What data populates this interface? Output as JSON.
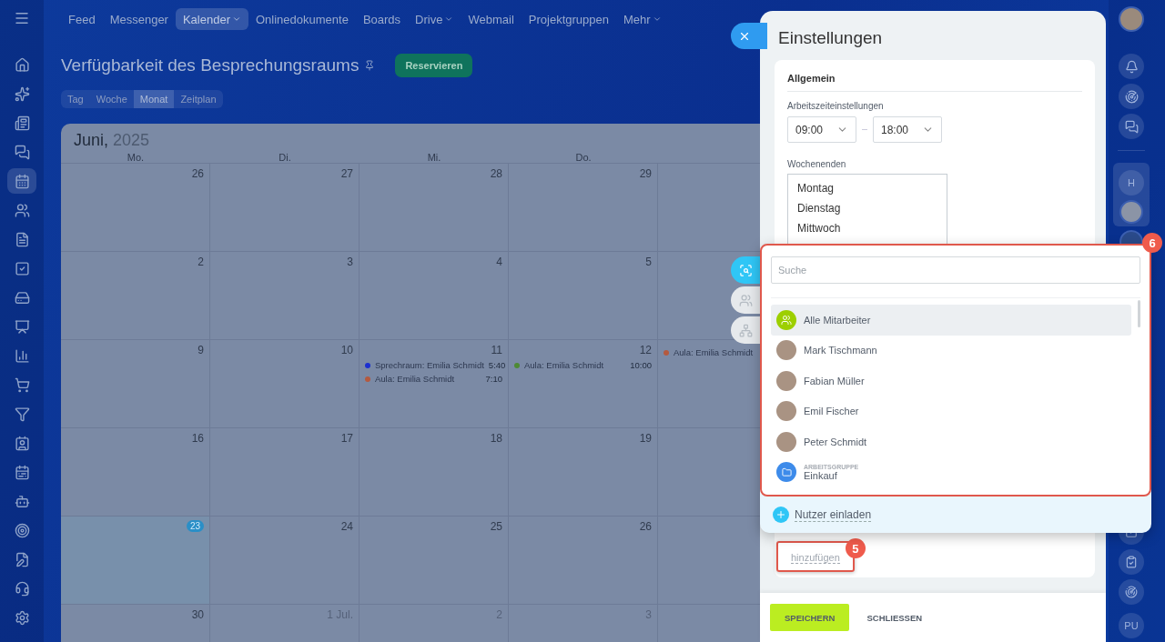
{
  "sidebar": {
    "items": [
      {
        "selected": false
      },
      {
        "selected": false
      },
      {
        "selected": false
      },
      {
        "selected": false
      },
      {
        "selected": true
      },
      {
        "selected": false
      },
      {
        "selected": false
      },
      {
        "selected": false
      },
      {
        "selected": false
      },
      {
        "selected": false
      },
      {
        "selected": false
      },
      {
        "selected": false
      },
      {
        "selected": false
      },
      {
        "selected": false
      },
      {
        "selected": false
      },
      {
        "selected": false
      },
      {
        "selected": false
      },
      {
        "selected": false
      },
      {
        "selected": false
      },
      {
        "selected": false
      }
    ]
  },
  "top_nav": [
    {
      "label": "Feed",
      "selected": false,
      "dropdown": false
    },
    {
      "label": "Messenger",
      "selected": false,
      "dropdown": false
    },
    {
      "label": "Kalender",
      "selected": true,
      "dropdown": true
    },
    {
      "label": "Onlinedokumente",
      "selected": false,
      "dropdown": false
    },
    {
      "label": "Boards",
      "selected": false,
      "dropdown": false
    },
    {
      "label": "Drive",
      "selected": false,
      "dropdown": true
    },
    {
      "label": "Webmail",
      "selected": false,
      "dropdown": false
    },
    {
      "label": "Projektgruppen",
      "selected": false,
      "dropdown": false
    },
    {
      "label": "Mehr",
      "selected": false,
      "dropdown": true
    }
  ],
  "page": {
    "title": "Verfügbarkeit des Besprechungsraums",
    "action": "Reservieren"
  },
  "view_tabs": [
    {
      "label": "Tag",
      "selected": false
    },
    {
      "label": "Woche",
      "selected": false
    },
    {
      "label": "Monat",
      "selected": true
    },
    {
      "label": "Zeitplan",
      "selected": false
    }
  ],
  "calendar": {
    "month": "Juni,",
    "year": "2025",
    "weekdays": [
      "Mo.",
      "Di.",
      "Mi.",
      "Do."
    ],
    "weeks": [
      {
        "cells": [
          {
            "date": "26"
          },
          {
            "date": "27"
          },
          {
            "date": "28"
          },
          {
            "date": "29"
          }
        ]
      },
      {
        "cells": [
          {
            "date": "2"
          },
          {
            "date": "3"
          },
          {
            "date": "4"
          },
          {
            "date": "5"
          }
        ]
      },
      {
        "cells": [
          {
            "date": "9"
          },
          {
            "date": "10"
          },
          {
            "date": "11",
            "events": [
              {
                "title": "Sprechraum: Emilia Schmidt",
                "time": "5:40",
                "color": "#1b2fd0"
              },
              {
                "title": "Aula: Emilia Schmidt",
                "time": "7:10",
                "color": "#b45a3f"
              }
            ]
          },
          {
            "date": "12",
            "events": [
              {
                "title": "Aula: Emilia Schmidt",
                "time": "10:00",
                "color": "#4e8a34"
              }
            ]
          },
          {
            "events": [
              {
                "title": "Aula: Emilia Schmidt",
                "color": "#b45a3f"
              }
            ]
          }
        ]
      },
      {
        "cells": [
          {
            "date": "16"
          },
          {
            "date": "17"
          },
          {
            "date": "18"
          },
          {
            "date": "19"
          }
        ]
      },
      {
        "cells": [
          {
            "date": "23",
            "today": true
          },
          {
            "date": "24"
          },
          {
            "date": "25"
          },
          {
            "date": "26"
          }
        ]
      },
      {
        "cells": [
          {
            "date": "30"
          },
          {
            "date": "1 Jul.",
            "other_month": true
          },
          {
            "date": "2",
            "other_month": true
          },
          {
            "date": "3",
            "other_month": true
          }
        ]
      }
    ]
  },
  "settings": {
    "title": "Einstellungen",
    "section": "Allgemein",
    "work_time_label": "Arbeitszeiteinstellungen",
    "from": "09:00",
    "to": "18:00",
    "weekends_label": "Wochenenden",
    "weekends": [
      "Montag",
      "Dienstag",
      "Mittwoch"
    ],
    "add_link": "hinzufügen",
    "save": "SPEICHERN",
    "close": "SCHLIESSEN"
  },
  "selector": {
    "tabs": [
      {
        "selected": true
      },
      {
        "selected": false
      },
      {
        "selected": false
      }
    ],
    "search": {
      "placeholder": "Suche"
    },
    "items": [
      {
        "kind": "group",
        "name": "Alle Mitarbeiter",
        "selected": true
      },
      {
        "kind": "user",
        "name": "Mark Tischmann",
        "selected": false
      },
      {
        "kind": "user",
        "name": "Fabian Müller",
        "selected": false
      },
      {
        "kind": "user",
        "name": "Emil Fischer",
        "selected": false
      },
      {
        "kind": "user",
        "name": "Peter Schmidt",
        "selected": false
      },
      {
        "kind": "workgroup",
        "caption": "ARBEITSGRUPPE",
        "name": "Einkauf",
        "selected": false
      }
    ],
    "invite": "Nutzer einladen"
  },
  "annotations": [
    {
      "label": "6"
    },
    {
      "label": "5"
    }
  ],
  "right_rail": {
    "group_initial": "H",
    "bottom_initials": "PU"
  }
}
